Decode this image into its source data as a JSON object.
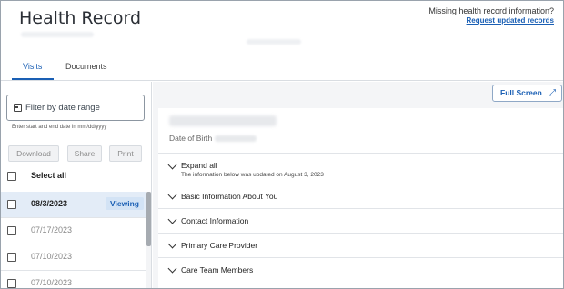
{
  "header": {
    "title": "Health Record",
    "missing_text": "Missing health record information?",
    "request_link": "Request updated records"
  },
  "tabs": [
    {
      "label": "Visits",
      "active": true
    },
    {
      "label": "Documents",
      "active": false
    }
  ],
  "filter": {
    "placeholder": "Filter by date range",
    "help": "Enter start and end date in mm/dd/yyyy"
  },
  "actions": {
    "download": "Download",
    "share": "Share",
    "print": "Print"
  },
  "select_all_label": "Select all",
  "visits": [
    {
      "date": "08/3/2023",
      "badge": "Viewing",
      "active": true
    },
    {
      "date": "07/17/2023",
      "active": false
    },
    {
      "date": "07/10/2023",
      "active": false
    },
    {
      "date": "07/10/2023",
      "active": false
    }
  ],
  "viewer": {
    "fullscreen_label": "Full Screen",
    "fullscreen_icon": "expand-arrows-icon",
    "dob_label": "Date of Birth",
    "sections": [
      {
        "label": "Expand all",
        "sub": "The information below was updated on August 3, 2023"
      },
      {
        "label": "Basic Information About You"
      },
      {
        "label": "Contact Information"
      },
      {
        "label": "Primary Care Provider"
      },
      {
        "label": "Care Team Members"
      }
    ]
  },
  "colors": {
    "accent": "#1a5fb4",
    "active_row": "#e3ecf7",
    "badge_bg": "#d3e3f5"
  }
}
